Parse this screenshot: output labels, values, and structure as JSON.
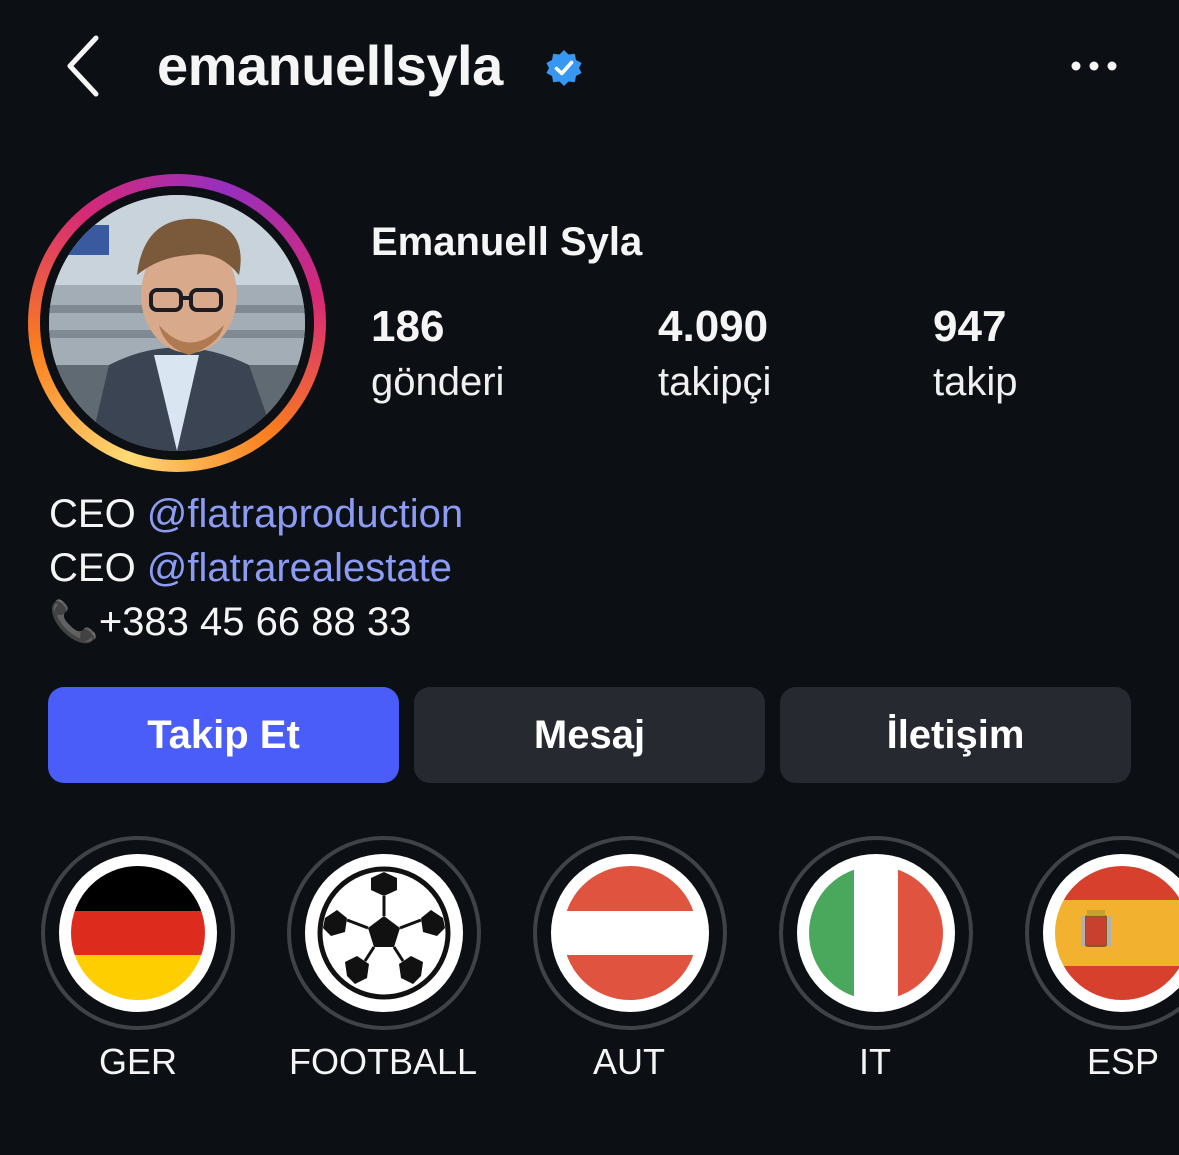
{
  "header": {
    "username": "emanuellsyla",
    "back_icon": "chevron-left-icon",
    "verified_icon": "verified-badge-icon",
    "more_icon": "more-horizontal-icon"
  },
  "profile": {
    "full_name": "Emanuell Syla",
    "stats": [
      {
        "value": "186",
        "label": "gönderi"
      },
      {
        "value": "4.090",
        "label": "takipçi"
      },
      {
        "value": "947",
        "label": "takip"
      }
    ],
    "bio": [
      {
        "prefix": "CEO ",
        "mention": "@flatraproduction"
      },
      {
        "prefix": "CEO ",
        "mention": "@flatrarealestate"
      },
      {
        "prefix": "📞",
        "text": "+383 45 66 88 33"
      }
    ]
  },
  "buttons": {
    "follow": "Takip Et",
    "message": "Mesaj",
    "contact": "İletişim"
  },
  "highlights": [
    {
      "label": "GER",
      "icon": "germany-flag-icon"
    },
    {
      "label": "FOOTBALL",
      "icon": "soccer-ball-icon"
    },
    {
      "label": "AUT",
      "icon": "austria-flag-icon"
    },
    {
      "label": "IT",
      "icon": "italy-flag-icon"
    },
    {
      "label": "ESP",
      "icon": "spain-flag-icon"
    }
  ],
  "colors": {
    "background": "#0c1014",
    "follow_button": "#4a5df9",
    "secondary_button": "#262a30",
    "mention": "#8c9cf5",
    "verified": "#3897f0"
  }
}
